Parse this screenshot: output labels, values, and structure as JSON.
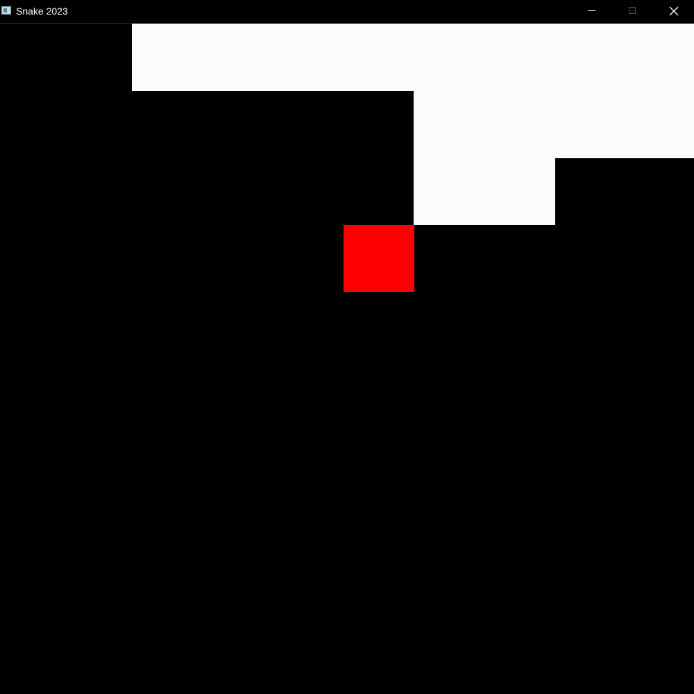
{
  "window": {
    "title": "Snake 2023",
    "icon": "app-window-icon",
    "controls": [
      "minimize-icon",
      "maximize-icon",
      "close-icon"
    ]
  },
  "game": {
    "grid": {
      "columns": 10,
      "visible_rows": 10
    },
    "colors": {
      "background": "#000000",
      "snake": "#fcfcfc",
      "food": "#ff0000"
    },
    "snake": [
      {
        "col": 2,
        "row": 0
      },
      {
        "col": 3,
        "row": 0
      },
      {
        "col": 4,
        "row": 0
      },
      {
        "col": 5,
        "row": 0
      },
      {
        "col": 6,
        "row": 0
      },
      {
        "col": 7,
        "row": 0
      },
      {
        "col": 8,
        "row": 0
      },
      {
        "col": 9,
        "row": 0
      },
      {
        "col": 6,
        "row": 1
      },
      {
        "col": 7,
        "row": 1
      },
      {
        "col": 8,
        "row": 1
      },
      {
        "col": 9,
        "row": 1
      },
      {
        "col": 6,
        "row": 2
      },
      {
        "col": 7,
        "row": 2
      }
    ],
    "food": {
      "col": 5,
      "row": 3
    }
  }
}
